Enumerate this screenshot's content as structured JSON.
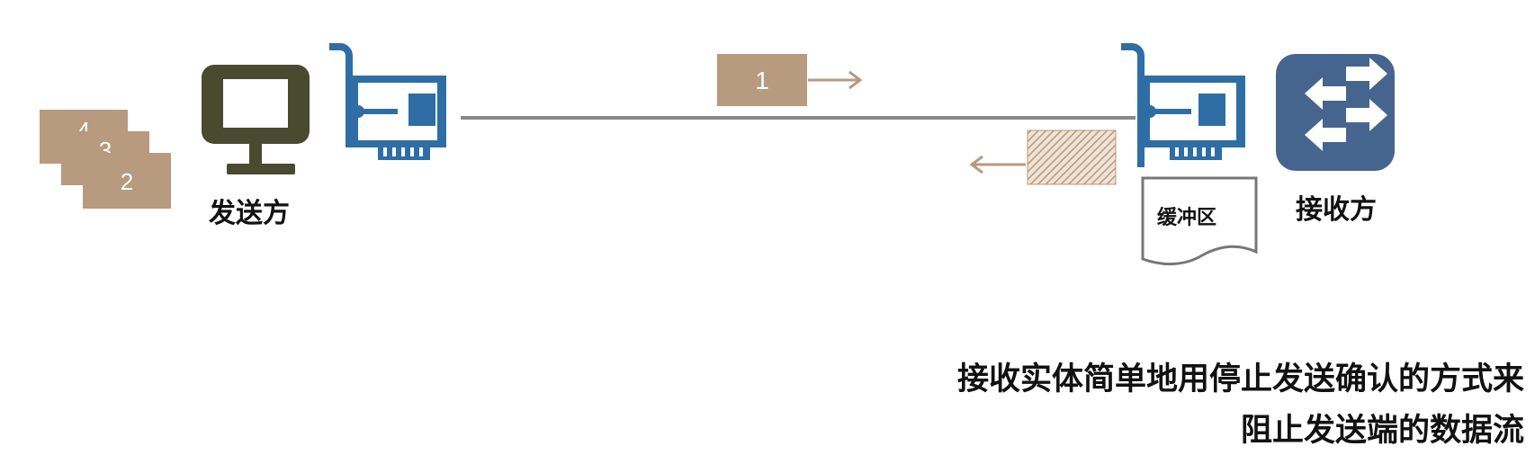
{
  "sender": {
    "label": "发送方"
  },
  "receiver": {
    "label": "接收方"
  },
  "buffer": {
    "label": "缓冲区"
  },
  "packets": {
    "queued": [
      "4",
      "3",
      "2"
    ],
    "in_flight": "1"
  },
  "caption": {
    "line1": "接收实体简单地用停止发送确认的方式来",
    "line2": "阻止发送端的数据流"
  },
  "colors": {
    "packet": "#b89a7e",
    "nic_blue": "#2f6ea5",
    "monitor": "#4a4a30",
    "switch": "#46658e",
    "wire": "#888888",
    "arrow": "#b89a7e"
  },
  "icons": {
    "sender": "monitor-icon",
    "sender_nic": "network-card-icon",
    "receiver_nic": "network-card-icon",
    "receiver": "switch-icon",
    "buffer": "document-icon"
  }
}
